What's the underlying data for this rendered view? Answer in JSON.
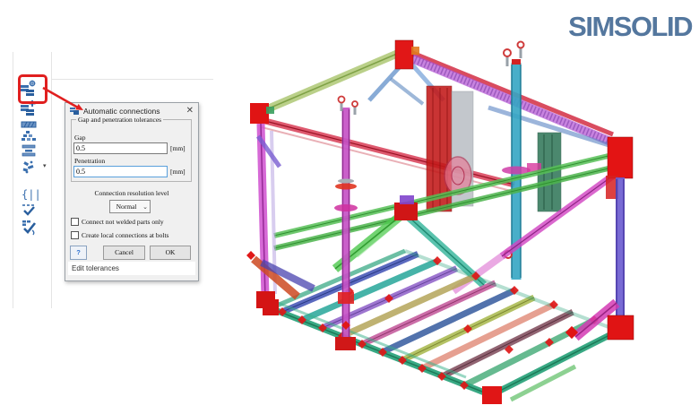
{
  "logo": {
    "text": "SIMSOLID",
    "color": "#54779e"
  },
  "annotation": {
    "color": "#e01f1f"
  },
  "toolbar": {
    "dropdown_caret": "▾",
    "items": [
      {
        "icon": "auto-connections-icon"
      },
      {
        "icon": "add-connection-icon"
      },
      {
        "icon": "seam-weld-icon"
      },
      {
        "icon": "spot-weld-group-icon"
      },
      {
        "icon": "laminate-weld-icon"
      },
      {
        "icon": "fastener-icon"
      },
      {
        "icon": "virtual-connector-icon"
      },
      {
        "icon": "review-connections-icon"
      },
      {
        "icon": "verify-connections-icon"
      }
    ]
  },
  "dialog": {
    "title": "Automatic connections",
    "close_glyph": "✕",
    "group_title": "Gap and penetration tolerances",
    "gap_label": "Gap",
    "gap_value": "0.5",
    "gap_unit": "[mm]",
    "penetration_label": "Penetration",
    "penetration_value": "0.5",
    "penetration_unit": "[mm]",
    "resolution_label": "Connection resolution level",
    "resolution_value": "Normal",
    "resolution_caret": "⌄",
    "checkbox1_label": "Connect not welded parts only",
    "checkbox1_checked": false,
    "checkbox2_label": "Create local connections at bolts",
    "checkbox2_checked": false,
    "help_label": "?",
    "cancel_label": "Cancel",
    "ok_label": "OK",
    "status_text": "Edit tolerances"
  },
  "model": {
    "palette": {
      "joint_red": "#e01616",
      "roof_green": "#a9c56c",
      "beam_crimson": "#d42440",
      "beam_purple": "#b14fd2",
      "column_magenta": "#c653c6",
      "column_cyan": "#35a6c4",
      "column_indigo": "#6a5ad0",
      "rail_teal": "#2fa57e",
      "brace_green": "#4ec94e"
    }
  }
}
